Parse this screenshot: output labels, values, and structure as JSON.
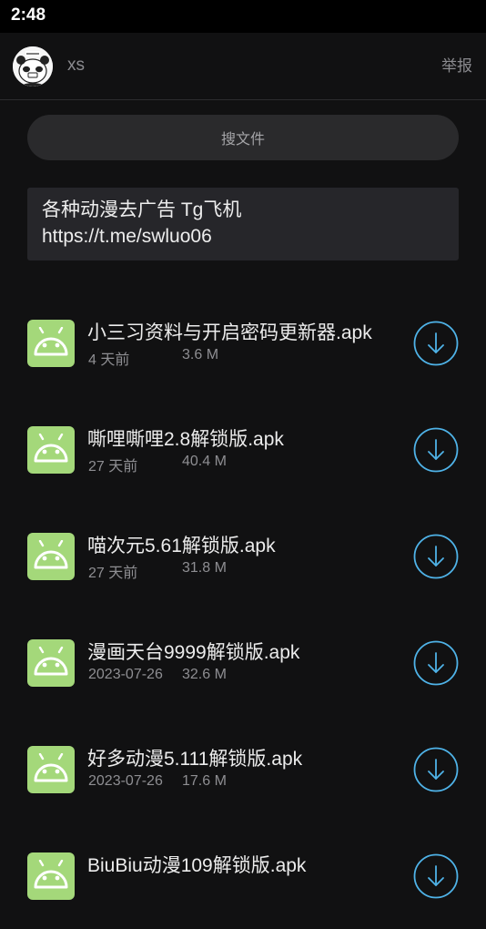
{
  "status_bar": {
    "time": "2:48"
  },
  "header": {
    "username": "xs",
    "report_label": "举报",
    "avatar_icon": "panda-meme-avatar-icon"
  },
  "search": {
    "label": "搜文件"
  },
  "notice": {
    "lines": [
      "各种动漫去广告 Tg飞机",
      "https://t.me/swluo06"
    ]
  },
  "files": [
    {
      "name": "小三习资料与开启密码更新器.apk",
      "date": "4 天前",
      "size": "3.6 M"
    },
    {
      "name": "嘶哩嘶哩2.8解锁版.apk",
      "date": "27 天前",
      "size": "40.4 M"
    },
    {
      "name": "喵次元5.61解锁版.apk",
      "date": "27 天前",
      "size": "31.8 M"
    },
    {
      "name": "漫画天台9999解锁版.apk",
      "date": "2023-07-26",
      "size": "32.6 M"
    },
    {
      "name": "好多动漫5.111解锁版.apk",
      "date": "2023-07-26",
      "size": "17.6 M"
    },
    {
      "name": "BiuBiu动漫109解锁版.apk",
      "date": "",
      "size": ""
    }
  ],
  "icons": {
    "file": "android-apk-icon",
    "download": "download-arrow-icon"
  },
  "colors": {
    "accent": "#4fb3e8",
    "apk_icon_bg": "#a4d87a",
    "background": "#111112"
  }
}
